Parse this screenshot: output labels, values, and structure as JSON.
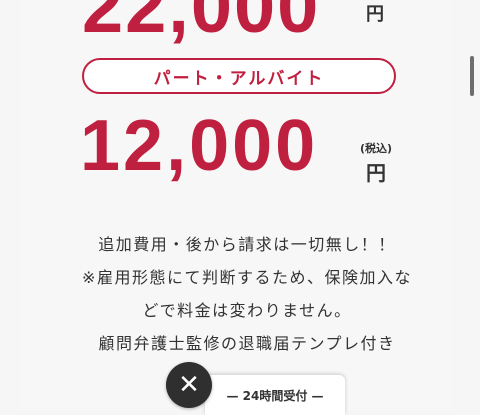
{
  "top_price": {
    "amount": "22,000",
    "yen": "円"
  },
  "plan": {
    "label": "パート・アルバイト",
    "price": "12,000",
    "tax_note": "(税込)",
    "yen": "円"
  },
  "description": [
    "追加費用・後から請求は一切無し！！",
    "※雇用形態にて判断するため、保険加入な",
    "どで料金は変わりません。",
    "顧問弁護士監修の退職届テンプレ付き"
  ],
  "close_button": {
    "icon": "✕"
  },
  "hours_panel": {
    "label": "— 24時間受付 —"
  },
  "colors": {
    "accent": "#c0203f",
    "text": "#333333",
    "background": "#f7f7f7"
  }
}
